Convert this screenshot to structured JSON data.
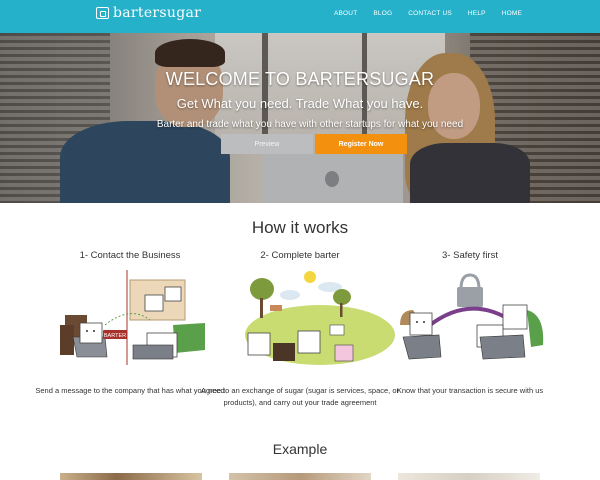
{
  "brand": {
    "name": "bartersugar"
  },
  "nav": {
    "items": [
      "ABOUT",
      "BLOG",
      "CONTACT US",
      "HELP",
      "HOME"
    ]
  },
  "hero": {
    "title": "WELCOME TO BARTERSUGAR",
    "subtitle": "Get What you need. Trade What you have.",
    "description": "Barter and trade what you have with other startups for what you need",
    "preview_label": "Preview",
    "register_label": "Register Now"
  },
  "how": {
    "title": "How it works",
    "steps": [
      {
        "title": "1- Contact the Business",
        "description": "Send a message to the company that has what you need",
        "tag": "BARTER"
      },
      {
        "title": "2- Complete barter",
        "description": "Agree to an exchange of sugar (sugar is services, space, or products), and carry out your trade agreement"
      },
      {
        "title": "3- Safety first",
        "description": "Know that your transaction is secure with us"
      }
    ]
  },
  "example": {
    "title": "Example"
  },
  "colors": {
    "navbar": "#25b1c9",
    "register": "#f3910f",
    "preview": "#bbbdbf"
  }
}
